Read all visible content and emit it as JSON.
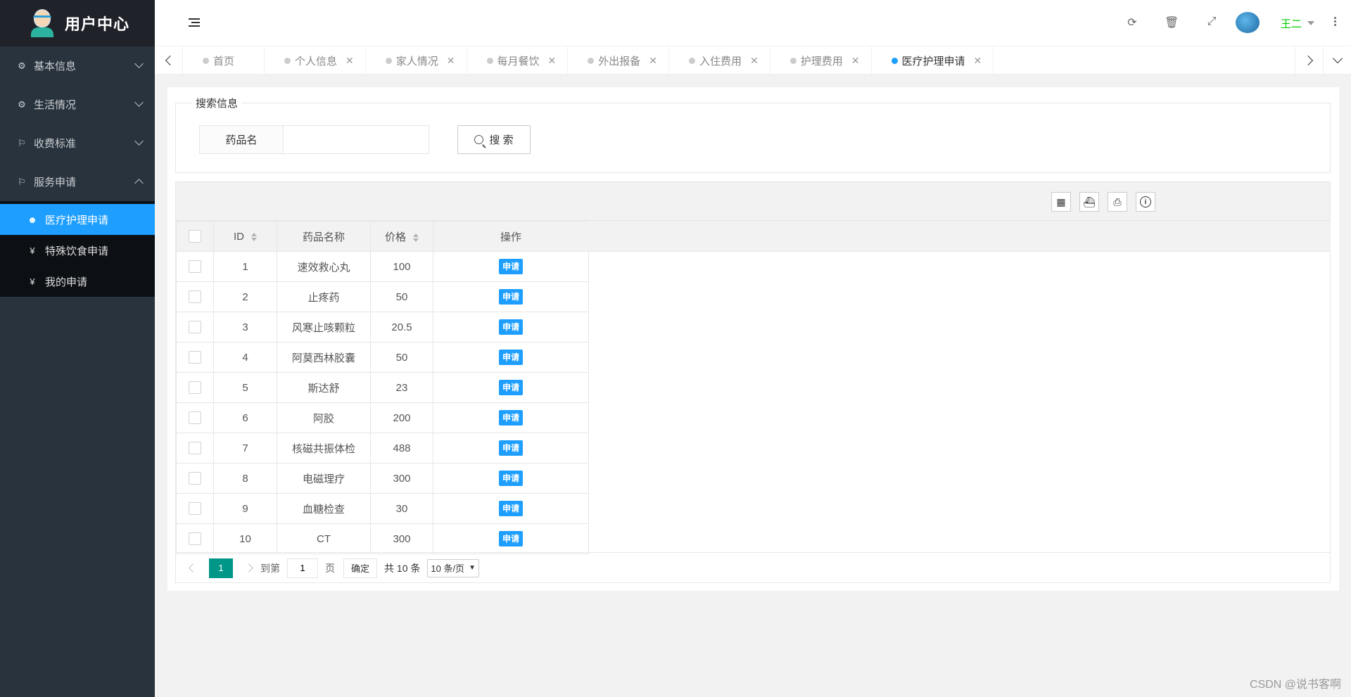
{
  "app": {
    "title": "用户中心"
  },
  "sidebar": {
    "groups": [
      {
        "label": "基本信息",
        "icon": "gears-icon",
        "expanded": false
      },
      {
        "label": "生活情况",
        "icon": "gears-icon",
        "expanded": false
      },
      {
        "label": "收费标准",
        "icon": "flag-icon",
        "expanded": false
      },
      {
        "label": "服务申请",
        "icon": "flag-icon",
        "expanded": true
      }
    ],
    "submenu": [
      {
        "label": "医疗护理申请",
        "icon": "face-icon",
        "active": true
      },
      {
        "label": "特殊饮食申请",
        "icon": "yen-icon",
        "active": false
      },
      {
        "label": "我的申请",
        "icon": "yen-icon",
        "active": false
      }
    ]
  },
  "header": {
    "username": "王二"
  },
  "tabs": [
    {
      "label": "首页",
      "closable": false,
      "active": false
    },
    {
      "label": "个人信息",
      "closable": true,
      "active": false
    },
    {
      "label": "家人情况",
      "closable": true,
      "active": false
    },
    {
      "label": "每月餐饮",
      "closable": true,
      "active": false
    },
    {
      "label": "外出报备",
      "closable": true,
      "active": false
    },
    {
      "label": "入住费用",
      "closable": true,
      "active": false
    },
    {
      "label": "护理费用",
      "closable": true,
      "active": false
    },
    {
      "label": "医疗护理申请",
      "closable": true,
      "active": true
    }
  ],
  "search": {
    "legend": "搜索信息",
    "field_label": "药品名",
    "value": "",
    "button_label": "搜 索"
  },
  "table": {
    "columns": [
      "ID",
      "药品名称",
      "价格",
      "操作"
    ],
    "action_label": "申请",
    "rows": [
      {
        "id": "1",
        "name": "速效救心丸",
        "price": "100"
      },
      {
        "id": "2",
        "name": "止疼药",
        "price": "50"
      },
      {
        "id": "3",
        "name": "风寒止咳颗粒",
        "price": "20.5"
      },
      {
        "id": "4",
        "name": "阿莫西林胶囊",
        "price": "50"
      },
      {
        "id": "5",
        "name": "斯达舒",
        "price": "23"
      },
      {
        "id": "6",
        "name": "阿胶",
        "price": "200"
      },
      {
        "id": "7",
        "name": "核磁共振体检",
        "price": "488"
      },
      {
        "id": "8",
        "name": "电磁理疗",
        "price": "300"
      },
      {
        "id": "9",
        "name": "血糖检查",
        "price": "30"
      },
      {
        "id": "10",
        "name": "CT",
        "price": "300"
      }
    ]
  },
  "pager": {
    "current": "1",
    "goto_label": "到第",
    "goto_value": "1",
    "page_unit": "页",
    "confirm": "确定",
    "total": "共 10 条",
    "page_size": "10 条/页"
  },
  "watermark": "CSDN @说书客啊",
  "colors": {
    "accent": "#1e9fff",
    "pager_active": "#009688",
    "sidebar_bg": "#28333e"
  }
}
